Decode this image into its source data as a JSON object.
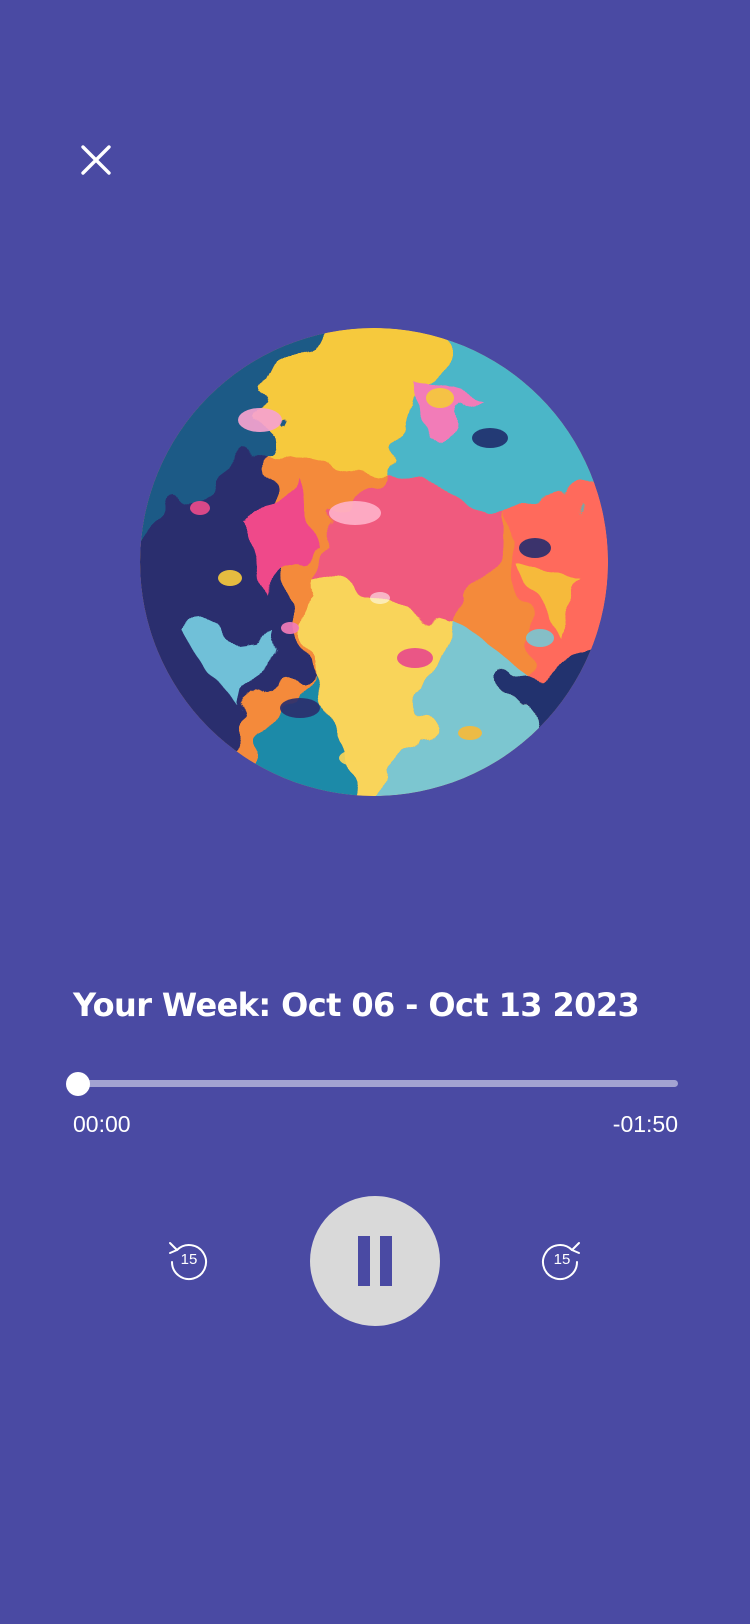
{
  "icons": {
    "close": "close-icon",
    "skip_back": "rewind-15-icon",
    "skip_forward": "forward-15-icon",
    "pause": "pause-icon"
  },
  "colors": {
    "background": "#4a4aa3",
    "text": "#ffffff",
    "track": "#a3a3d2",
    "control_fill": "#d9d9d9"
  },
  "player": {
    "title": "Your Week: Oct 06 - Oct 13 2023",
    "progress_fraction": 0,
    "elapsed": "00:00",
    "remaining": "-01:50",
    "skip_back_seconds": "15",
    "skip_forward_seconds": "15"
  }
}
